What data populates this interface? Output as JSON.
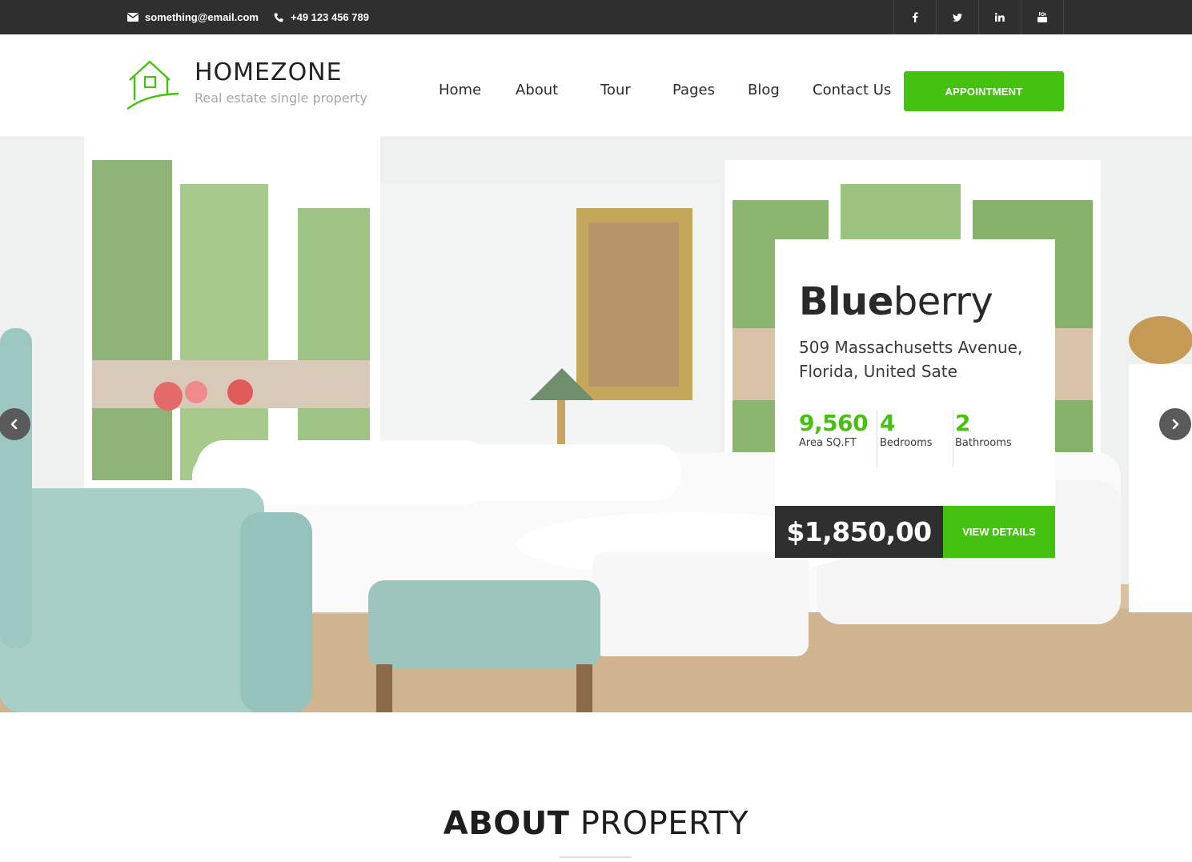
{
  "topbar": {
    "email": "something@email.com",
    "phone": "+49 123 456 789",
    "socials": [
      {
        "name": "facebook",
        "glyph": "f"
      },
      {
        "name": "twitter",
        "glyph": "t"
      },
      {
        "name": "linkedin",
        "glyph": "in"
      },
      {
        "name": "youtube",
        "glyph": "yt"
      }
    ]
  },
  "header": {
    "brand": "HOMEZONE",
    "tagline": "Real estate single property",
    "nav": [
      "Home",
      "About",
      "Tour",
      "Pages",
      "Blog",
      "Contact Us"
    ],
    "cta": "APPOINTMENT"
  },
  "hero": {
    "property_name_bold": "Blue",
    "property_name_rest": "berry",
    "address_line1": "509 Massachusetts Avenue,",
    "address_line2": "Florida, United Sate",
    "stats": [
      {
        "value": "9,560",
        "label": "Area SQ.FT"
      },
      {
        "value": "4",
        "label": "Bedrooms"
      },
      {
        "value": "2",
        "label": "Bathrooms"
      }
    ],
    "price": "$1,850,00",
    "details_label": "VIEW DETAILS"
  },
  "about": {
    "title_bold": "ABOUT",
    "title_rest": "PROPERTY"
  },
  "colors": {
    "accent": "#44c20f",
    "dark": "#2f2f2f",
    "text": "#2b2b2b",
    "muted": "#a5a5a5"
  },
  "icons": [
    "envelope-icon",
    "phone-icon",
    "house-logo-icon",
    "chevron-left-icon",
    "chevron-right-icon"
  ]
}
